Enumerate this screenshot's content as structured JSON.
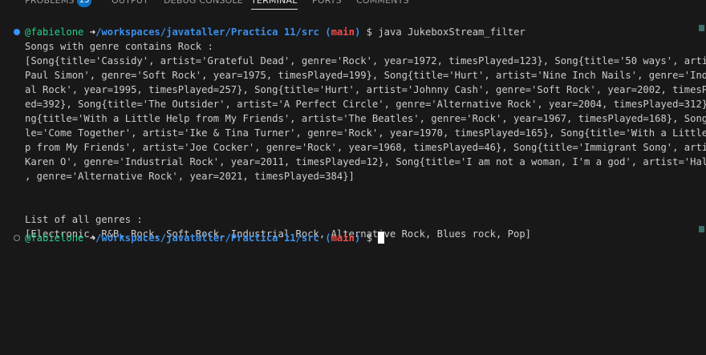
{
  "panel": {
    "tabs": [
      {
        "label": "PROBLEMS",
        "badge": "13"
      },
      {
        "label": "OUTPUT"
      },
      {
        "label": "DEBUG CONSOLE"
      },
      {
        "label": "TERMINAL",
        "active": true
      },
      {
        "label": "PORTS"
      },
      {
        "label": "COMMENTS"
      }
    ]
  },
  "terminal": {
    "prompt": {
      "user": "@fabielone",
      "arrow": "➜",
      "path": "/workspaces/javataller/Practica 11/src",
      "branch_open": "(",
      "branch": "main",
      "branch_close": ")",
      "symbol": "$"
    },
    "command": "java JukeboxStream_filter",
    "output": [
      "Songs with genre contains Rock :",
      "[Song{title='Cassidy', artist='Grateful Dead', genre='Rock', year=1972, timesPlayed=123}, Song{title='50 ways', artist='",
      "Paul Simon', genre='Soft Rock', year=1975, timesPlayed=199}, Song{title='Hurt', artist='Nine Inch Nails', genre='Industri",
      "al Rock', year=1995, timesPlayed=257}, Song{title='Hurt', artist='Johnny Cash', genre='Soft Rock', year=2002, timesPlay",
      "ed=392}, Song{title='The Outsider', artist='A Perfect Circle', genre='Alternative Rock', year=2004, timesPlayed=312}, So",
      "ng{title='With a Little Help from My Friends', artist='The Beatles', genre='Rock', year=1967, timesPlayed=168}, Song{tit",
      "le='Come Together', artist='Ike & Tina Turner', genre='Rock', year=1970, timesPlayed=165}, Song{title='With a Little Hel",
      "p from My Friends', artist='Joe Cocker', genre='Rock', year=1968, timesPlayed=46}, Song{title='Immigrant Song', artist='",
      "Karen O', genre='Industrial Rock', year=2011, timesPlayed=12}, Song{title='I am not a woman, I'm a god', artist='Halsey'",
      ", genre='Alternative Rock', year=2021, timesPlayed=384}]",
      "",
      "",
      "List of all genres :",
      "[Electronic, R&B, Rock, Soft Rock, Industrial Rock, Alternative Rock, Blues rock, Pop]"
    ]
  },
  "colors": {
    "background": "#181818",
    "user": "#23d18b",
    "path": "#3b8eea",
    "branch": "#f14c4c",
    "text": "#cccccc",
    "badge": "#0e70c0"
  }
}
